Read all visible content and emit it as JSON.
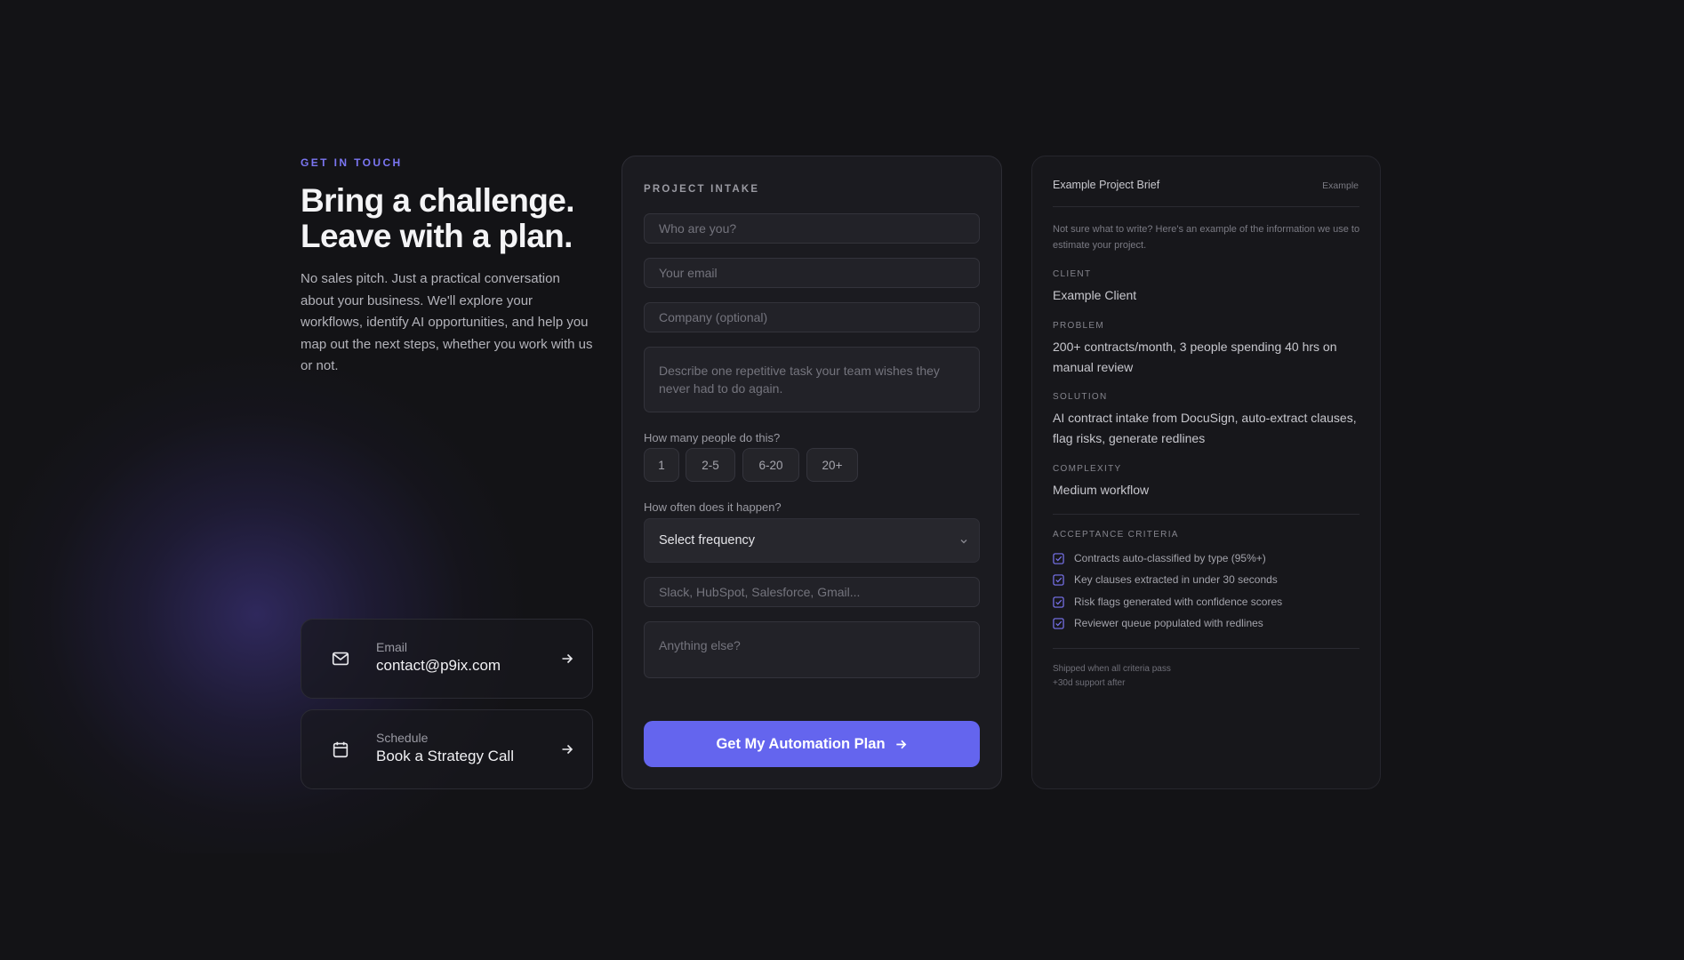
{
  "hero": {
    "eyebrow": "GET IN TOUCH",
    "headline_line1": "Bring a challenge.",
    "headline_line2": "Leave with a plan.",
    "intro": "No sales pitch. Just a practical conversation about your business. We'll explore your workflows, identify AI opportunities, and help you map out the next steps, whether you work with us or not."
  },
  "contacts": [
    {
      "label": "Email",
      "value": "contact@p9ix.com",
      "icon": "mail-icon"
    },
    {
      "label": "Schedule",
      "value": "Book a Strategy Call",
      "icon": "calendar-icon"
    }
  ],
  "form": {
    "title": "PROJECT INTAKE",
    "name_placeholder": "Who are you?",
    "email_placeholder": "Your email",
    "company_placeholder": "Company (optional)",
    "task_placeholder": "Describe one repetitive task your team wishes they never had to do again.",
    "people_question": "How many people do this?",
    "people_options": [
      "1",
      "2-5",
      "6-20",
      "20+"
    ],
    "frequency_question": "How often does it happen?",
    "frequency_value": "Select frequency",
    "tools_placeholder": "Slack, HubSpot, Salesforce, Gmail...",
    "notes_placeholder": "Anything else?",
    "submit_label": "Get My Automation Plan"
  },
  "brief": {
    "title": "Example Project Brief",
    "tag": "Example",
    "note": "Not sure what to write? Here's an example of the information we use to estimate your project.",
    "client_label": "CLIENT",
    "client_value": "Example Client",
    "problem_label": "PROBLEM",
    "problem_value": "200+ contracts/month, 3 people spending 40 hrs on manual review",
    "solution_label": "SOLUTION",
    "solution_value": "AI contract intake from DocuSign, auto-extract clauses, flag risks, generate redlines",
    "complexity_label": "COMPLEXITY",
    "complexity_value": "Medium workflow",
    "criteria_label": "ACCEPTANCE CRITERIA",
    "criteria": [
      "Contracts auto-classified by type (95%+)",
      "Key clauses extracted in under 30 seconds",
      "Risk flags generated with confidence scores",
      "Reviewer queue populated with redlines"
    ],
    "footer_line1": "Shipped when all criteria pass",
    "footer_line2": "+30d support after"
  },
  "colors": {
    "accent": "#6465ee",
    "eyebrow": "#7b76f2",
    "background": "#131316",
    "checkbox": "#7a74f0"
  }
}
